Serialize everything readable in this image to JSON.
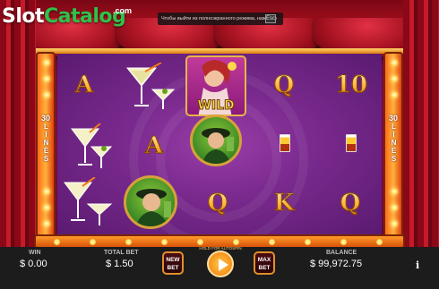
{
  "branding": {
    "logo_part1": "Slot",
    "logo_part2": "Catalog",
    "logo_suffix": ".com"
  },
  "notice": {
    "text": "Чтобы выйти из полноэкранного режима, нажмите",
    "key": "Esc"
  },
  "sidebar": {
    "left": {
      "count": "30",
      "word": "LINES"
    },
    "right": {
      "count": "30",
      "word": "LINES"
    }
  },
  "reels": {
    "wild_label": "WILD",
    "symbols": {
      "r1c1": "A",
      "r1c4": "Q",
      "r1c5": "10",
      "r2c3": "A",
      "r3c4": "Q",
      "r3c5": "K",
      "r3c6": "Q"
    }
  },
  "bottom_bar": {
    "win_label": "WIN",
    "win_value": "$ 0.00",
    "total_bet_label": "TOTAL BET",
    "total_bet_value": "$ 1.50",
    "new_bet_line1": "NEW",
    "new_bet_line2": "BET",
    "hold_label": "HOLD FOR AUTOSPIN",
    "max_bet_line1": "MAX",
    "max_bet_line2": "BET",
    "balance_label": "BALANCE",
    "balance_value": "$ 99,972.75",
    "info_label": "i"
  },
  "colors": {
    "accent": "#e0902a",
    "logo_green": "#2ec24a",
    "reel_bg": "#7a2a8e"
  }
}
